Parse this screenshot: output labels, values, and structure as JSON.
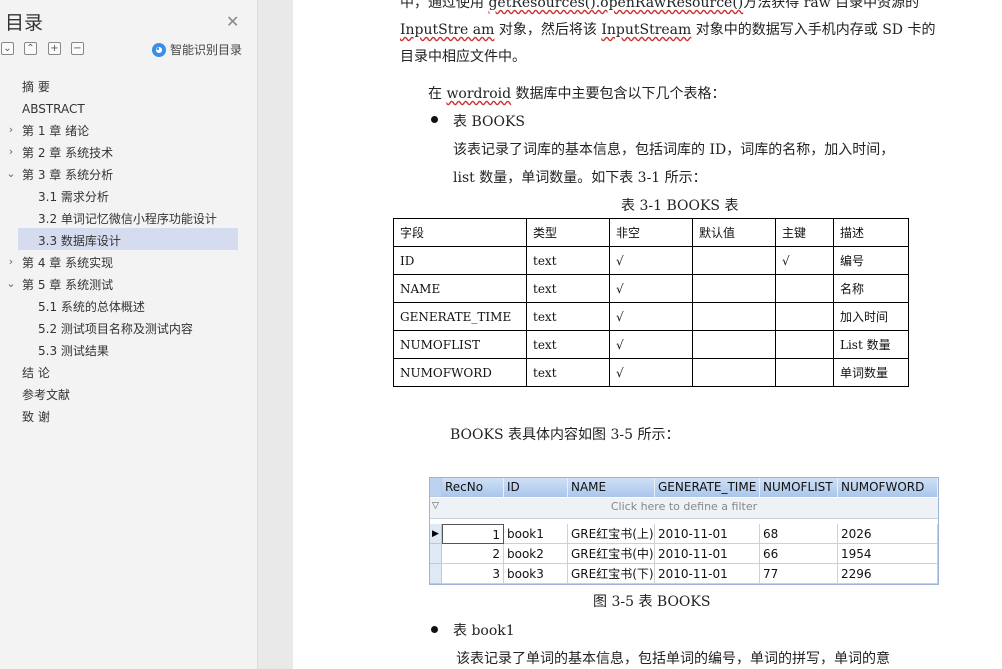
{
  "sidebar": {
    "title": "目录",
    "close_icon": "close-icon",
    "toolbar": {
      "expand_icon": "expand-all-icon",
      "collapse_icon": "collapse-icon",
      "add_icon": "add-icon",
      "remove_icon": "remove-icon"
    },
    "smart_label": "智能识别目录",
    "items": [
      {
        "label": "摘    要"
      },
      {
        "label": "ABSTRACT"
      },
      {
        "label": "第 1 章  绪论"
      },
      {
        "label": "第 2 章  系统技术"
      },
      {
        "label": "第 3 章  系统分析"
      },
      {
        "label": "3.1 需求分析"
      },
      {
        "label": "3.2 单词记忆微信小程序功能设计"
      },
      {
        "label": "3.3 数据库设计"
      },
      {
        "label": "第 4 章  系统实现"
      },
      {
        "label": "第 5 章  系统测试"
      },
      {
        "label": "5.1 系统的总体概述"
      },
      {
        "label": "5.2 测试项目名称及测试内容"
      },
      {
        "label": "5.3 测试结果"
      },
      {
        "label": "结    论"
      },
      {
        "label": "参考文献"
      },
      {
        "label": "致    谢"
      }
    ],
    "selected_color": "#d6dcf0"
  },
  "doc": {
    "line1a": "中，通过使用 ",
    "line1b": "getResources().openRawResource()",
    "line1c": "方法获得 raw 目录中资源的",
    "line2a": "InputStre am",
    "line2b": " 对象，然后将该 ",
    "line2c": "InputStream",
    "line2d": " 对象中的数据写入手机内存或 SD 卡的",
    "line3": "目录中相应文件中。",
    "para_a": "在 ",
    "para_b": "wordroid",
    "para_c": " 数据库中主要包含以下几个表格：",
    "bullet1": "表 BOOKS",
    "desc1": "该表记录了词库的基本信息，包括词库的 ID，词库的名称，加入时间，",
    "desc2": "list 数量，单词数量。如下表 3-1 所示：",
    "table_caption": "表 3-1 BOOKS 表",
    "table": {
      "headers": [
        "字段",
        "类型",
        "非空",
        "默认值",
        "主键",
        "描述"
      ],
      "rows": [
        [
          "ID",
          "text",
          "√",
          "",
          "√",
          "编号"
        ],
        [
          "NAME",
          "text",
          "√",
          "",
          "",
          "名称"
        ],
        [
          "GENERATE_TIME",
          "text",
          "√",
          "",
          "",
          "加入时间"
        ],
        [
          "NUMOFLIST",
          "text",
          "√",
          "",
          "",
          "List 数量"
        ],
        [
          "NUMOFWORD",
          "text",
          "√",
          "",
          "",
          "单词数量"
        ]
      ]
    },
    "fig_intro": "BOOKS 表具体内容如图 3-5 所示：",
    "grid": {
      "headers": [
        "RecNo",
        "ID",
        "NAME",
        "GENERATE_TIME",
        "NUMOFLIST",
        "NUMOFWORD"
      ],
      "filter_text": "Click here to define a filter",
      "rows": [
        [
          "1",
          "book1",
          "GRE红宝书(上)",
          "2010-11-01",
          "68",
          "2026"
        ],
        [
          "2",
          "book2",
          "GRE红宝书(中)",
          "2010-11-01",
          "66",
          "1954"
        ],
        [
          "3",
          "book3",
          "GRE红宝书(下)",
          "2010-11-01",
          "77",
          "2296"
        ]
      ]
    },
    "fig_caption": "图 3-5  表 BOOKS",
    "bullet2": "表 book1",
    "desc3": "该表记录了单词的基本信息，包括单词的编号，单词的拼写，单词的意"
  }
}
